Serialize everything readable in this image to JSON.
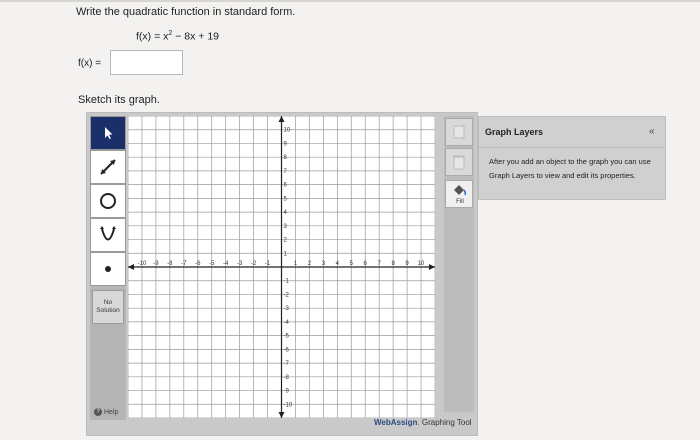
{
  "question": {
    "prompt": "Write the quadratic function in standard form.",
    "given_lhs": "f(x) = x",
    "given_exp": "2",
    "given_rhs": " − 8x + 19",
    "answer_label": "f(x) =",
    "answer_value": ""
  },
  "sketch": {
    "label": "Sketch its graph."
  },
  "tools": {
    "items": [
      {
        "name": "select-tool",
        "icon": "pointer-arrow-icon",
        "active": true
      },
      {
        "name": "line-tool",
        "icon": "line-arrows-icon",
        "active": false
      },
      {
        "name": "circle-tool",
        "icon": "circle-icon",
        "active": false
      },
      {
        "name": "parabola-tool",
        "icon": "parabola-icon",
        "active": false
      },
      {
        "name": "point-tool",
        "icon": "point-icon",
        "active": false
      }
    ],
    "no_solution_label": "No Solution",
    "help_label": "Help"
  },
  "graph": {
    "x_ticks": [
      "-10",
      "-9",
      "-8",
      "-7",
      "-6",
      "-5",
      "-4",
      "-3",
      "-2",
      "-1",
      "1",
      "2",
      "3",
      "4",
      "5",
      "6",
      "7",
      "8",
      "9",
      "10"
    ],
    "y_ticks": [
      "10",
      "9",
      "8",
      "7",
      "6",
      "5",
      "4",
      "3",
      "2",
      "1",
      "-1",
      "-2",
      "-3",
      "-4",
      "-5",
      "-6",
      "-7",
      "-8",
      "-9",
      "-10"
    ],
    "xlim": [
      -11,
      11
    ],
    "ylim": [
      -11,
      11
    ]
  },
  "right_tools": {
    "fill_label": "Fill"
  },
  "footer": {
    "brand_main": "WebAssign",
    "brand_dot": ".",
    "brand_suffix": " Graphing Tool"
  },
  "layers": {
    "title": "Graph Layers",
    "collapse_glyph": "«",
    "body": "After you add an object to the graph you can use Graph Layers to view and edit its properties."
  },
  "colors": {
    "active_tool": "#1b2f6b",
    "grid_line": "#9a9a9a",
    "axis": "#222222",
    "brand": "#2c4d86"
  }
}
